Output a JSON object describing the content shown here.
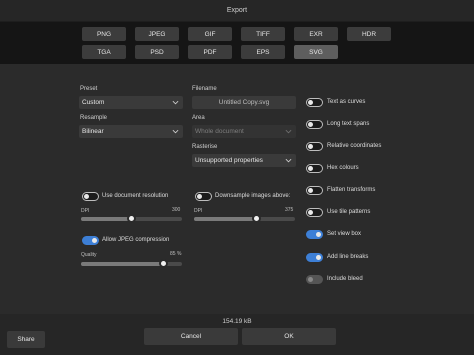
{
  "window": {
    "title": "Export"
  },
  "formats": [
    {
      "label": "PNG"
    },
    {
      "label": "JPEG"
    },
    {
      "label": "GIF"
    },
    {
      "label": "TIFF"
    },
    {
      "label": "EXR"
    },
    {
      "label": "HDR"
    },
    {
      "label": "TGA"
    },
    {
      "label": "PSD"
    },
    {
      "label": "PDF"
    },
    {
      "label": "EPS"
    },
    {
      "label": "SVG",
      "selected": true
    }
  ],
  "left": {
    "preset_label": "Preset",
    "preset_value": "Custom",
    "resample_label": "Resample",
    "resample_value": "Bilinear",
    "use_doc_resolution": {
      "label": "Use document resolution",
      "on": false
    },
    "dpi": {
      "label": "DPI",
      "value": "300",
      "level": 0.5
    },
    "allow_jpeg": {
      "label": "Allow JPEG compression",
      "on": true
    },
    "quality": {
      "label": "Quality",
      "value": "85 %",
      "level": 0.82
    }
  },
  "middle": {
    "filename_label": "Filename",
    "filename_value": "Untitled Copy.svg",
    "area_label": "Area",
    "area_value": "Whole document",
    "rasterise_label": "Rasterise",
    "rasterise_value": "Unsupported properties",
    "downsample": {
      "label": "Downsample images above:",
      "on": false
    },
    "dpi": {
      "label": "DPI",
      "value": "375",
      "level": 0.62
    }
  },
  "right_options": [
    {
      "label": "Text as curves",
      "state": "off"
    },
    {
      "label": "Long text spans",
      "state": "off"
    },
    {
      "label": "Relative coordinates",
      "state": "off"
    },
    {
      "label": "Hex colours",
      "state": "off"
    },
    {
      "label": "Flatten transforms",
      "state": "off"
    },
    {
      "label": "Use tile patterns",
      "state": "off"
    },
    {
      "label": "Set view box",
      "state": "on"
    },
    {
      "label": "Add line breaks",
      "state": "on"
    },
    {
      "label": "Include bleed",
      "state": "disabled"
    }
  ],
  "footer": {
    "file_size": "154.19 kB",
    "share_label": "Share",
    "cancel_label": "Cancel",
    "ok_label": "OK"
  },
  "colors": {
    "accent": "#3d7fd6",
    "background": "#2b2b2b",
    "format_panel": "#151515"
  }
}
